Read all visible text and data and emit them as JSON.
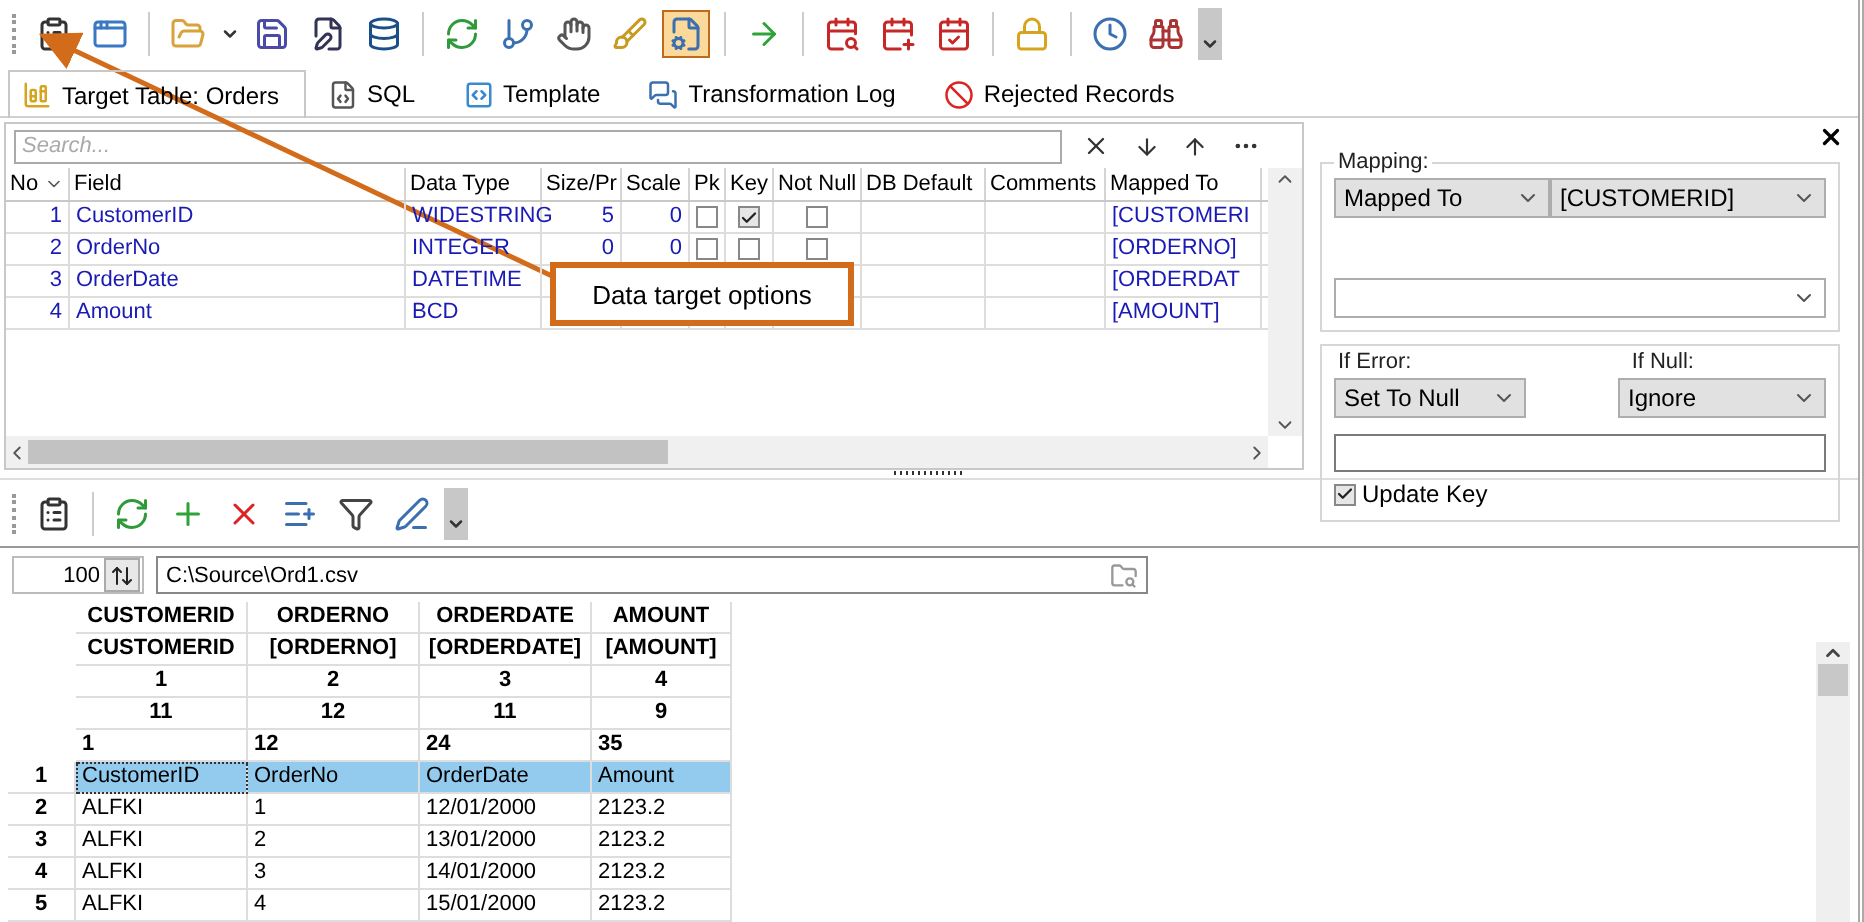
{
  "toolbar_groups": [
    {
      "items": [
        {
          "kind": "properties",
          "selected": false
        },
        {
          "kind": "window-edit",
          "selected": false
        }
      ]
    },
    {
      "items": [
        {
          "kind": "open",
          "selected": false,
          "has_menu": true
        },
        {
          "kind": "save",
          "selected": false
        },
        {
          "kind": "form-edit",
          "selected": false
        },
        {
          "kind": "database",
          "selected": false
        }
      ]
    },
    {
      "items": [
        {
          "kind": "refresh",
          "selected": false
        },
        {
          "kind": "tree",
          "selected": false
        },
        {
          "kind": "pan",
          "selected": false
        },
        {
          "kind": "brush",
          "selected": false
        },
        {
          "kind": "document-settings",
          "selected": true
        }
      ]
    },
    {
      "items": [
        {
          "kind": "run",
          "selected": false
        }
      ]
    },
    {
      "items": [
        {
          "kind": "calendar-search",
          "selected": false
        },
        {
          "kind": "calendar-add",
          "selected": false
        },
        {
          "kind": "calendar-check",
          "selected": false
        }
      ]
    },
    {
      "items": [
        {
          "kind": "lock",
          "selected": false
        }
      ]
    },
    {
      "items": [
        {
          "kind": "clock",
          "selected": false
        },
        {
          "kind": "binoculars",
          "selected": false
        }
      ]
    }
  ],
  "tabs": [
    {
      "label": "Target Table: Orders",
      "kind": "table",
      "selected": true
    },
    {
      "label": "SQL",
      "kind": "sql",
      "selected": false
    },
    {
      "label": "Template",
      "kind": "template",
      "selected": false
    },
    {
      "label": "Transformation Log",
      "kind": "log",
      "selected": false
    },
    {
      "label": "Rejected Records",
      "kind": "rejected",
      "selected": false
    }
  ],
  "fields_grid": {
    "search": {
      "placeholder": "Search..."
    },
    "columns": [
      "No",
      "Field",
      "Data Type",
      "Size/Pr",
      "Scale",
      "Pk",
      "Key",
      "Not Null",
      "DB Default",
      "Comments",
      "Mapped To"
    ],
    "rows": [
      {
        "no": "1",
        "field": "CustomerID",
        "data_type": "WIDESTRING",
        "size": "5",
        "scale": "0",
        "pk": false,
        "key": true,
        "not_null": false,
        "mapped_to": "[CUSTOMERI"
      },
      {
        "no": "2",
        "field": "OrderNo",
        "data_type": "INTEGER",
        "size": "0",
        "scale": "0",
        "pk": false,
        "key": false,
        "not_null": false,
        "mapped_to": "[ORDERNO]"
      },
      {
        "no": "3",
        "field": "OrderDate",
        "data_type": "DATETIME",
        "mapped_to": "[ORDERDAT"
      },
      {
        "no": "4",
        "field": "Amount",
        "data_type": "BCD",
        "mapped_to": "[AMOUNT]"
      }
    ]
  },
  "callout": {
    "text": "Data target options"
  },
  "mapping_panel": {
    "mapping_label": "Mapping:",
    "mapping_type": "Mapped To",
    "mapped_field": "[CUSTOMERID]",
    "if_error_label": "If Error:",
    "if_error": "Set To Null",
    "if_null_label": "If Null:",
    "if_null": "Ignore",
    "update_key": {
      "label": "Update Key",
      "checked": true
    }
  },
  "preview_toolbar": [
    {
      "kind": "properties"
    },
    {
      "kind": "refresh"
    },
    {
      "kind": "add"
    },
    {
      "kind": "delete"
    },
    {
      "kind": "new-list"
    },
    {
      "kind": "filter"
    },
    {
      "kind": "edit"
    }
  ],
  "preview": {
    "record_count": "100",
    "file_path": "C:\\Source\\Ord1.csv",
    "header_rows": [
      [
        "CUSTOMERID",
        "ORDERNO",
        "ORDERDATE",
        "AMOUNT"
      ],
      [
        "CUSTOMERID",
        "[ORDERNO]",
        "[ORDERDATE]",
        "[AMOUNT]"
      ],
      [
        "1",
        "2",
        "3",
        "4"
      ],
      [
        "11",
        "12",
        "11",
        "9"
      ],
      [
        "1",
        "12",
        "24",
        "35"
      ]
    ],
    "rows": [
      {
        "number": "1",
        "selected": true,
        "cells": [
          "CustomerID",
          "OrderNo",
          "OrderDate",
          "Amount"
        ]
      },
      {
        "number": "2",
        "selected": false,
        "cells": [
          "ALFKI",
          "1",
          "12/01/2000",
          "2123.2"
        ]
      },
      {
        "number": "3",
        "selected": false,
        "cells": [
          "ALFKI",
          "2",
          "13/01/2000",
          "2123.2"
        ]
      },
      {
        "number": "4",
        "selected": false,
        "cells": [
          "ALFKI",
          "3",
          "14/01/2000",
          "2123.2"
        ]
      },
      {
        "number": "5",
        "selected": false,
        "cells": [
          "ALFKI",
          "4",
          "15/01/2000",
          "2123.2"
        ]
      }
    ]
  }
}
